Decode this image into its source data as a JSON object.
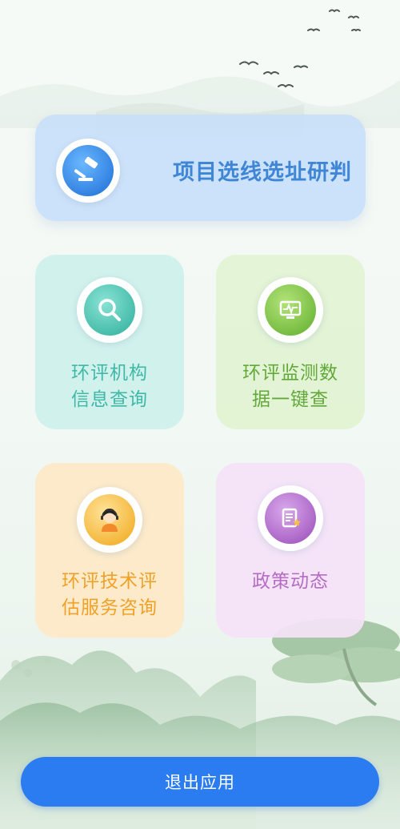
{
  "cards": {
    "top": {
      "label": "项目选线选址研判",
      "icon": "gavel-icon"
    },
    "agency": {
      "line1": "环评机构",
      "line2": "信息查询",
      "icon": "search-icon"
    },
    "monitoring": {
      "line1": "环评监测数",
      "line2": "据一键查",
      "icon": "monitor-icon"
    },
    "consult": {
      "line1": "环评技术评",
      "line2": "估服务咨询",
      "icon": "customer-service-icon"
    },
    "policy": {
      "label": "政策动态",
      "icon": "document-star-icon"
    }
  },
  "exit_button": {
    "label": "退出应用"
  },
  "colors": {
    "top_text": "#3f86d6",
    "teal_text": "#3fb8a6",
    "green_text": "#62a93a",
    "orange_text": "#f0a126",
    "purple_text": "#b66cc4",
    "exit_bg": "#2a7cf0"
  }
}
